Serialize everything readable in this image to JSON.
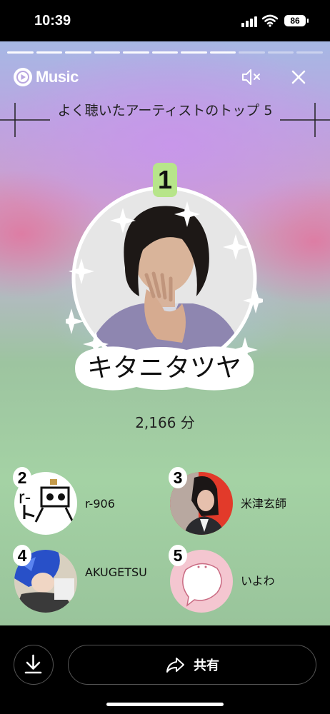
{
  "status_bar": {
    "time": "10:39",
    "battery": "86"
  },
  "story": {
    "progress_segments": 11,
    "progress_done": 8,
    "app_name": "Music",
    "title": "よく聴いたアーティストのトップ 5",
    "top_artist": {
      "rank": "1",
      "name": "キタニタツヤ",
      "minutes": "2,166 分"
    },
    "others": [
      {
        "rank": "2",
        "name": "r-906"
      },
      {
        "rank": "3",
        "name": "米津玄師"
      },
      {
        "rank": "4",
        "name": "AKUGETSU"
      },
      {
        "rank": "5",
        "name": "いよわ"
      }
    ]
  },
  "bottom": {
    "share_label": "共有"
  },
  "colors": {
    "rank_badge": "#b7e58a",
    "story_accent": "#c896eb"
  }
}
